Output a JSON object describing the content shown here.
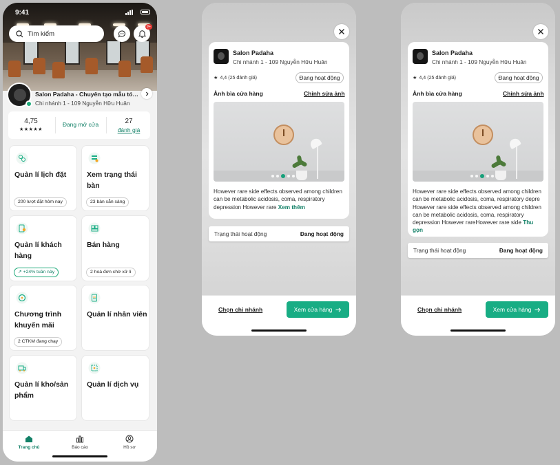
{
  "colors": {
    "accent": "#18ad84",
    "accent_dark": "#128067",
    "danger": "#e53935"
  },
  "home": {
    "status_time": "9:41",
    "search_placeholder": "Tìm kiếm",
    "notif_count": "9+",
    "salon_name": "Salon Padaha - Chuyên tạo mẫu tóc n...",
    "branch": "Chi nhánh 1 - 109 Nguyễn Hữu Huân",
    "rating_value": "4,75",
    "rating_stars": "★★★★★",
    "open_status": "Đang mở cửa",
    "review_count": "27",
    "review_label": "đánh giá",
    "cards": [
      {
        "title": "Quản lí lịch đặt",
        "chip": "200 lượt đặt hôm nay",
        "icon": "calendar-icon"
      },
      {
        "title": "Xem trạng thái bàn",
        "chip": "23 bàn sẵn sàng",
        "icon": "table-status-icon"
      },
      {
        "title": "Quản lí khách hàng",
        "chip": "+24% tuần này",
        "icon": "customer-icon"
      },
      {
        "title": "Bán hàng",
        "chip": "2 hoá đơn chờ xử lí",
        "icon": "sales-icon"
      },
      {
        "title": "Chương trình khuyến mãi",
        "chip": "2 CTKM đang chạy",
        "icon": "promotion-icon"
      },
      {
        "title": "Quản lí nhân viên",
        "chip": "",
        "icon": "staff-icon"
      },
      {
        "title": "Quản lí kho/sản phẩm",
        "chip": "",
        "icon": "inventory-icon"
      },
      {
        "title": "Quản lí dịch vụ",
        "chip": "",
        "icon": "service-icon"
      }
    ],
    "tabs": [
      {
        "label": "Trang chủ",
        "icon": "home-icon",
        "active": true
      },
      {
        "label": "Báo cáo",
        "icon": "chart-icon",
        "active": false
      },
      {
        "label": "Hồ sơ",
        "icon": "profile-icon",
        "active": false
      }
    ]
  },
  "detail": {
    "salon_name": "Salon Padaha",
    "branch": "Chi nhánh 1 - 109 Nguyễn Hữu Huân",
    "rating": "4,4 (25 đánh giá)",
    "status_pill": "Đang hoạt động",
    "cover_label": "Ảnh bìa cửa hàng",
    "edit_cover": "Chỉnh sửa ảnh",
    "desc_short": "However rare side effects observed among children can be metabolic acidosis, coma, respiratory depression However rare",
    "see_more": "Xem thêm",
    "desc_long": "However rare side effects observed among children can be metabolic acidosis, coma, respiratory depre However rare side effects observed among children can be metabolic acidosis, coma, respiratory depression However rareHowever rare side",
    "see_less": "Thu gọn",
    "op_status_label": "Trạng thái hoạt động",
    "op_status_value": "Đang hoạt động",
    "choose_branch": "Chọn chi nhánh",
    "view_store": "Xem cửa hàng"
  }
}
